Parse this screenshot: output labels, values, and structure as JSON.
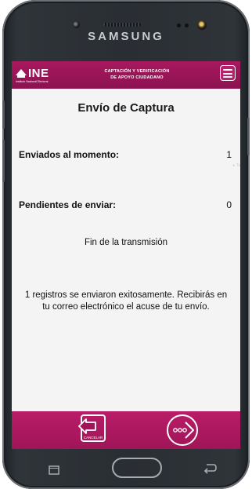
{
  "device": {
    "brand": "SAMSUNG"
  },
  "app_bar": {
    "logo_text": "INE",
    "logo_subtext": "Instituto Nacional Electoral",
    "title_line1": "CAPTACIÓN Y VERIFICACIÓN",
    "title_line2": "DE APOYO CIUDADANO",
    "menu_icon": "hamburger-menu-icon"
  },
  "page": {
    "title": "Envío de Captura",
    "sent_label": "Enviados al momento:",
    "sent_value": "1",
    "pending_label": "Pendientes de enviar:",
    "pending_value": "0",
    "status": "Fin de la transmisión",
    "message": "1 registros se enviaron exitosamente. Recibirás en tu correo electrónico el acuse de tu envío."
  },
  "bottom_bar": {
    "cancel_label": "CANCELAR",
    "cancel_icon": "cancel-exit-icon",
    "next_icon": "next-arrow-icon"
  },
  "colors": {
    "brand": "#a8185f",
    "bottom_bar": "#b91c68",
    "content_bg": "#f4f4f4"
  }
}
